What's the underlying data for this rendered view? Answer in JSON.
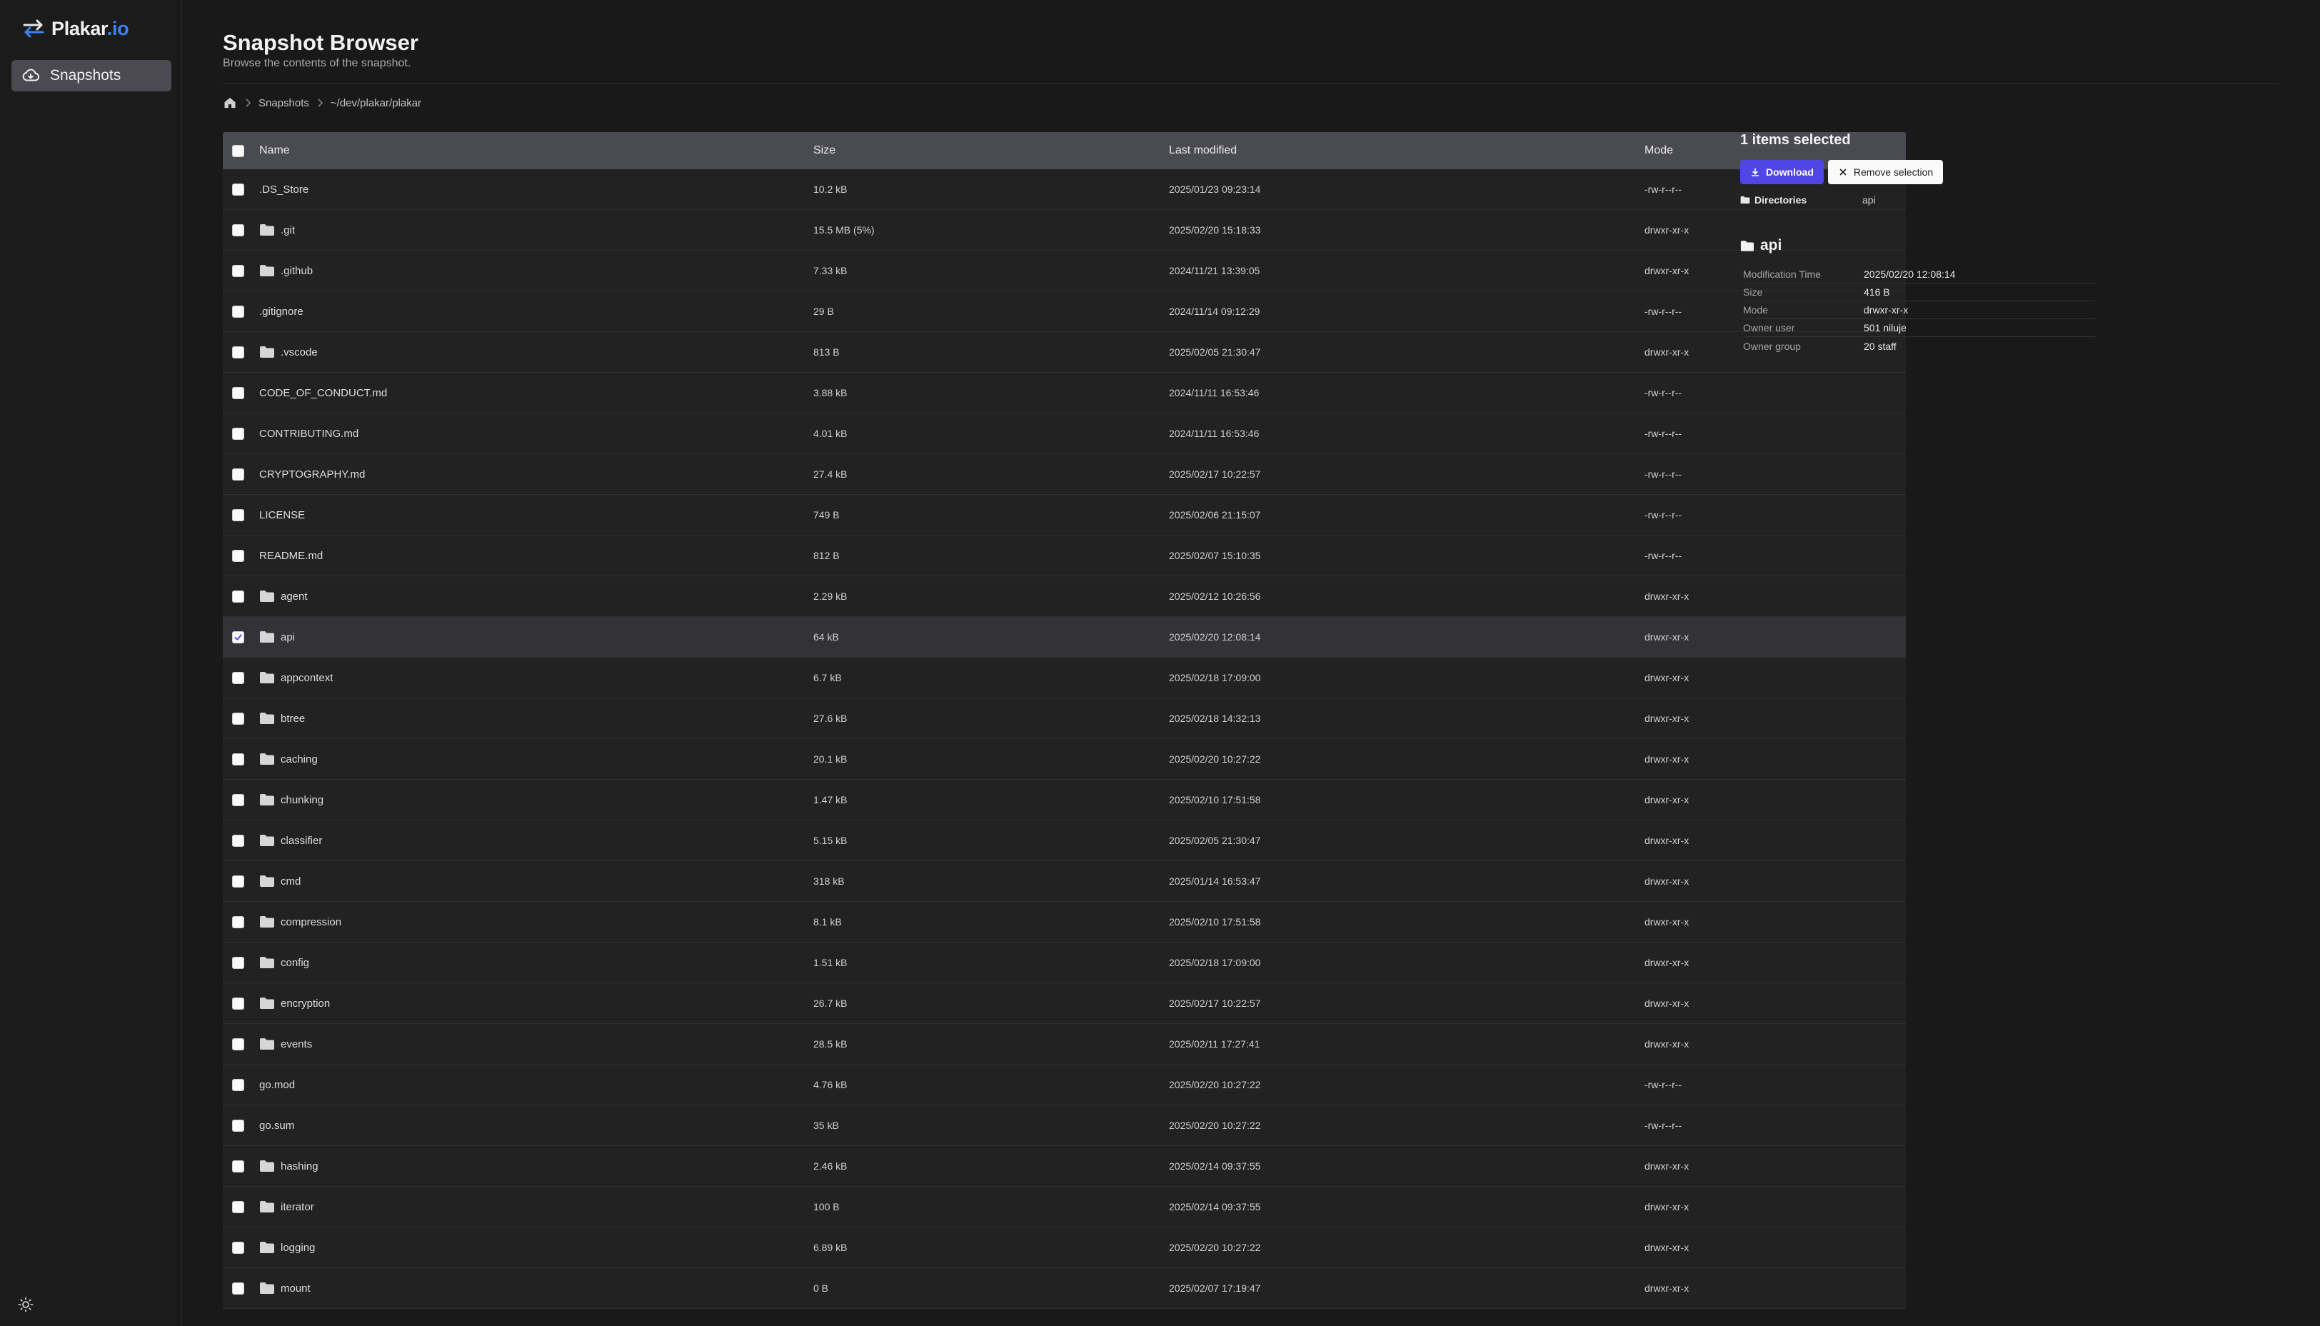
{
  "brand": {
    "name": "Plakar",
    "suffix": ".io",
    "accent": "#3b82f6"
  },
  "sidebar": {
    "items": [
      {
        "label": "Snapshots",
        "icon": "cloud-download-icon",
        "active": true
      }
    ]
  },
  "page": {
    "title": "Snapshot Browser",
    "subtitle": "Browse the contents of the snapshot."
  },
  "breadcrumb": {
    "home_icon": "home-icon",
    "items": [
      "Snapshots",
      "~/dev/plakar/plakar"
    ]
  },
  "table": {
    "headers": {
      "name": "Name",
      "size": "Size",
      "modified": "Last modified",
      "mode": "Mode"
    },
    "rows": [
      {
        "name": ".DS_Store",
        "type": "file",
        "size": "10.2 kB",
        "modified": "2025/01/23 09:23:14",
        "mode": "-rw-r--r--",
        "selected": false
      },
      {
        "name": ".git",
        "type": "dir",
        "size": "15.5 MB (5%)",
        "modified": "2025/02/20 15:18:33",
        "mode": "drwxr-xr-x",
        "selected": false
      },
      {
        "name": ".github",
        "type": "dir",
        "size": "7.33 kB",
        "modified": "2024/11/21 13:39:05",
        "mode": "drwxr-xr-x",
        "selected": false
      },
      {
        "name": ".gitignore",
        "type": "file",
        "size": "29 B",
        "modified": "2024/11/14 09:12:29",
        "mode": "-rw-r--r--",
        "selected": false
      },
      {
        "name": ".vscode",
        "type": "dir",
        "size": "813 B",
        "modified": "2025/02/05 21:30:47",
        "mode": "drwxr-xr-x",
        "selected": false
      },
      {
        "name": "CODE_OF_CONDUCT.md",
        "type": "file",
        "size": "3.88 kB",
        "modified": "2024/11/11 16:53:46",
        "mode": "-rw-r--r--",
        "selected": false
      },
      {
        "name": "CONTRIBUTING.md",
        "type": "file",
        "size": "4.01 kB",
        "modified": "2024/11/11 16:53:46",
        "mode": "-rw-r--r--",
        "selected": false
      },
      {
        "name": "CRYPTOGRAPHY.md",
        "type": "file",
        "size": "27.4 kB",
        "modified": "2025/02/17 10:22:57",
        "mode": "-rw-r--r--",
        "selected": false
      },
      {
        "name": "LICENSE",
        "type": "file",
        "size": "749 B",
        "modified": "2025/02/06 21:15:07",
        "mode": "-rw-r--r--",
        "selected": false
      },
      {
        "name": "README.md",
        "type": "file",
        "size": "812 B",
        "modified": "2025/02/07 15:10:35",
        "mode": "-rw-r--r--",
        "selected": false
      },
      {
        "name": "agent",
        "type": "dir",
        "size": "2.29 kB",
        "modified": "2025/02/12 10:26:56",
        "mode": "drwxr-xr-x",
        "selected": false
      },
      {
        "name": "api",
        "type": "dir",
        "size": "64 kB",
        "modified": "2025/02/20 12:08:14",
        "mode": "drwxr-xr-x",
        "selected": true
      },
      {
        "name": "appcontext",
        "type": "dir",
        "size": "6.7 kB",
        "modified": "2025/02/18 17:09:00",
        "mode": "drwxr-xr-x",
        "selected": false
      },
      {
        "name": "btree",
        "type": "dir",
        "size": "27.6 kB",
        "modified": "2025/02/18 14:32:13",
        "mode": "drwxr-xr-x",
        "selected": false
      },
      {
        "name": "caching",
        "type": "dir",
        "size": "20.1 kB",
        "modified": "2025/02/20 10:27:22",
        "mode": "drwxr-xr-x",
        "selected": false
      },
      {
        "name": "chunking",
        "type": "dir",
        "size": "1.47 kB",
        "modified": "2025/02/10 17:51:58",
        "mode": "drwxr-xr-x",
        "selected": false
      },
      {
        "name": "classifier",
        "type": "dir",
        "size": "5.15 kB",
        "modified": "2025/02/05 21:30:47",
        "mode": "drwxr-xr-x",
        "selected": false
      },
      {
        "name": "cmd",
        "type": "dir",
        "size": "318 kB",
        "modified": "2025/01/14 16:53:47",
        "mode": "drwxr-xr-x",
        "selected": false
      },
      {
        "name": "compression",
        "type": "dir",
        "size": "8.1 kB",
        "modified": "2025/02/10 17:51:58",
        "mode": "drwxr-xr-x",
        "selected": false
      },
      {
        "name": "config",
        "type": "dir",
        "size": "1.51 kB",
        "modified": "2025/02/18 17:09:00",
        "mode": "drwxr-xr-x",
        "selected": false
      },
      {
        "name": "encryption",
        "type": "dir",
        "size": "26.7 kB",
        "modified": "2025/02/17 10:22:57",
        "mode": "drwxr-xr-x",
        "selected": false
      },
      {
        "name": "events",
        "type": "dir",
        "size": "28.5 kB",
        "modified": "2025/02/11 17:27:41",
        "mode": "drwxr-xr-x",
        "selected": false
      },
      {
        "name": "go.mod",
        "type": "file",
        "size": "4.76 kB",
        "modified": "2025/02/20 10:27:22",
        "mode": "-rw-r--r--",
        "selected": false
      },
      {
        "name": "go.sum",
        "type": "file",
        "size": "35 kB",
        "modified": "2025/02/20 10:27:22",
        "mode": "-rw-r--r--",
        "selected": false
      },
      {
        "name": "hashing",
        "type": "dir",
        "size": "2.46 kB",
        "modified": "2025/02/14 09:37:55",
        "mode": "drwxr-xr-x",
        "selected": false
      },
      {
        "name": "iterator",
        "type": "dir",
        "size": "100 B",
        "modified": "2025/02/14 09:37:55",
        "mode": "drwxr-xr-x",
        "selected": false
      },
      {
        "name": "logging",
        "type": "dir",
        "size": "6.89 kB",
        "modified": "2025/02/20 10:27:22",
        "mode": "drwxr-xr-x",
        "selected": false
      },
      {
        "name": "mount",
        "type": "dir",
        "size": "0 B",
        "modified": "2025/02/07 17:19:47",
        "mode": "drwxr-xr-x",
        "selected": false
      }
    ]
  },
  "panel": {
    "selected_count": "1 items selected",
    "download_label": "Download",
    "remove_label": "Remove selection",
    "directories_label": "Directories",
    "directories_value": "api",
    "detail_title": "api",
    "details": [
      {
        "key": "Modification Time",
        "value": "2025/02/20 12:08:14"
      },
      {
        "key": "Size",
        "value": "416 B"
      },
      {
        "key": "Mode",
        "value": "drwxr-xr-x"
      },
      {
        "key": "Owner user",
        "value": "501 niluje"
      },
      {
        "key": "Owner group",
        "value": "20 staff"
      }
    ]
  },
  "colors": {
    "accent": "#4f46e5",
    "background": "#1a1919",
    "header_bg": "#4a4a52",
    "selected_row": "#333236"
  },
  "footer": {
    "theme_icon": "sun-icon"
  }
}
